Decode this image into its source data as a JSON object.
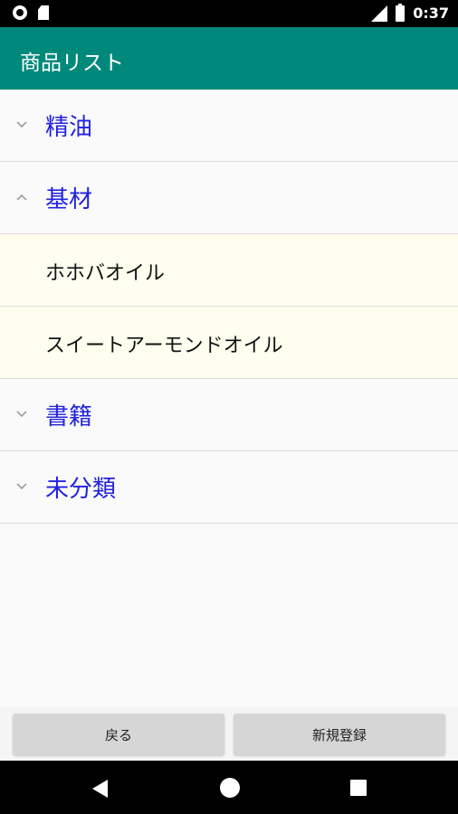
{
  "status_bar": {
    "time": "0:37",
    "icons": [
      "record-icon",
      "sd-card-icon",
      "signal-icon",
      "battery-icon"
    ]
  },
  "app_bar": {
    "title": "商品リスト",
    "color": "#00897b"
  },
  "list": {
    "rows": [
      {
        "label": "精油",
        "type": "group",
        "expanded": false,
        "icon": "chevron-down-icon"
      },
      {
        "label": "基材",
        "type": "group",
        "expanded": true,
        "icon": "chevron-up-icon"
      },
      {
        "label": "ホホバオイル",
        "type": "item"
      },
      {
        "label": "スイートアーモンドオイル",
        "type": "item"
      },
      {
        "label": "書籍",
        "type": "group",
        "expanded": false,
        "icon": "chevron-down-icon"
      },
      {
        "label": "未分類",
        "type": "group",
        "expanded": false,
        "icon": "chevron-down-icon"
      }
    ],
    "group_color": "#2222dd",
    "item_background": "#fffff0"
  },
  "buttons": {
    "back_label": "戻る",
    "register_label": "新規登録"
  },
  "nav_bar": {
    "icons": [
      "back-triangle-icon",
      "home-circle-icon",
      "recent-square-icon"
    ]
  }
}
